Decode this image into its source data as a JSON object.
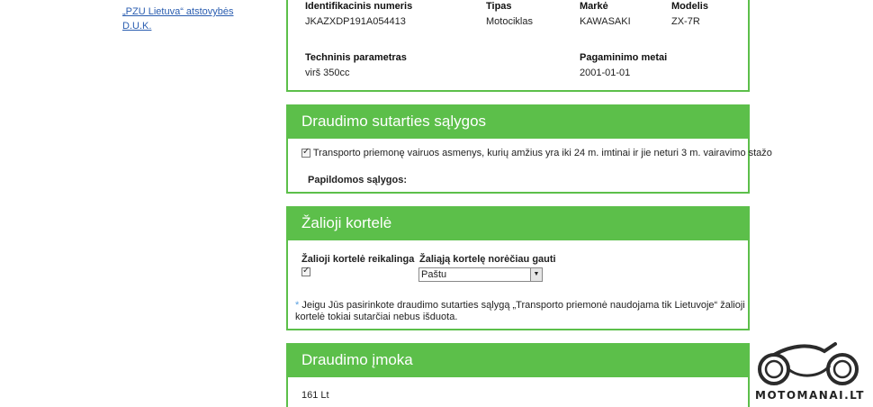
{
  "side_links": [
    "„PZU Lietuva“ atstovybės",
    "D.U.K."
  ],
  "vehicle": {
    "vin_label": "Identifikacinis numeris",
    "vin_value": "JKAZXDP191A054413",
    "type_label": "Tipas",
    "type_value": "Motociklas",
    "make_label": "Markė",
    "make_value": "KAWASAKI",
    "model_label": "Modelis",
    "model_value": "ZX-7R",
    "tech_label": "Techninis parametras",
    "tech_value": "virš 350cc",
    "year_label": "Pagaminimo metai",
    "year_value": "2001-01-01"
  },
  "conditions": {
    "title": "Draudimo sutarties sąlygos",
    "checkbox_text": "Transporto priemonę vairuos asmenys, kurių amžius yra iki 24 m. imtinai ir jie neturi 3 m. vairavimo stažo",
    "checked": true,
    "extra_label": "Papildomos sąlygos:"
  },
  "green_card": {
    "title": "Žalioji kortelė",
    "required_label": "Žalioji kortelė reikalinga",
    "required_checked": true,
    "delivery_label": "Žaliąją kortelę norėčiau gauti",
    "delivery_selected": "Paštu",
    "note_star": "*",
    "note_text": "Jeigu Jūs pasirinkote draudimo sutarties sąlygą „Transporto priemonė naudojama tik Lietuvoje“ žalioji kortelė tokiai sutarčiai nebus išduota."
  },
  "premium": {
    "title": "Draudimo įmoka",
    "amount": "161 Lt"
  },
  "logo": {
    "text": "MOTOMANAI.LT",
    "icon": "motorcycle-logo-icon"
  },
  "colors": {
    "accent_green": "#5cbf4a",
    "link_blue": "#2a5db0"
  }
}
